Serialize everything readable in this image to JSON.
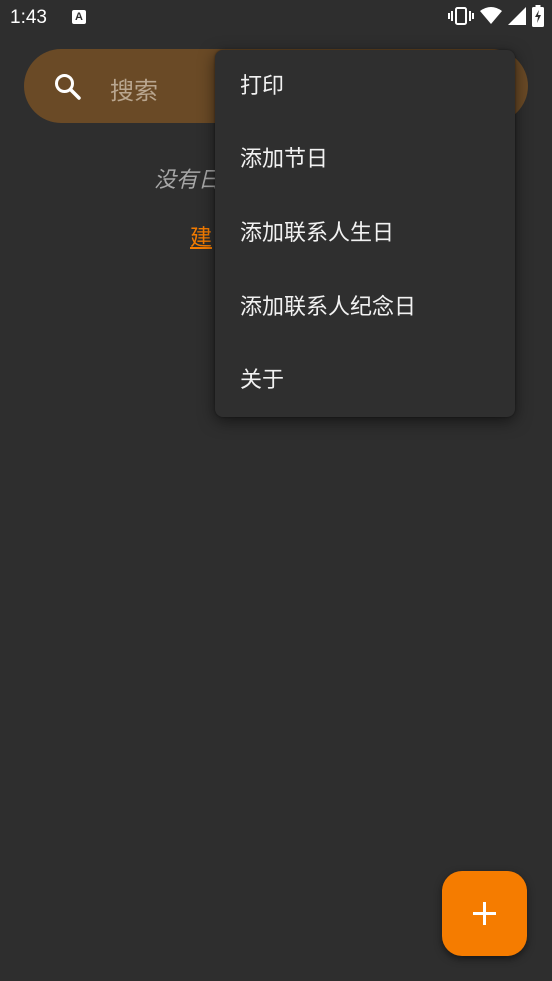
{
  "status_bar": {
    "time": "1:43",
    "notification_icon_letter": "A",
    "icons": [
      "vibrate-icon",
      "wifi-icon",
      "signal-icon",
      "battery-charging-icon"
    ]
  },
  "search": {
    "placeholder": "搜索"
  },
  "empty_state": {
    "message": "没有日",
    "create_link": "建"
  },
  "menu": {
    "items": [
      {
        "label": "打印"
      },
      {
        "label": "添加节日"
      },
      {
        "label": "添加联系人生日"
      },
      {
        "label": "添加联系人纪念日"
      },
      {
        "label": "关于"
      }
    ]
  },
  "fab": {
    "icon": "plus-icon",
    "color": "#f57c00"
  },
  "colors": {
    "background": "#2e2e2e",
    "search_bar": "#6a4a26",
    "accent": "#f57c00",
    "menu_background": "#2f2f2f"
  }
}
